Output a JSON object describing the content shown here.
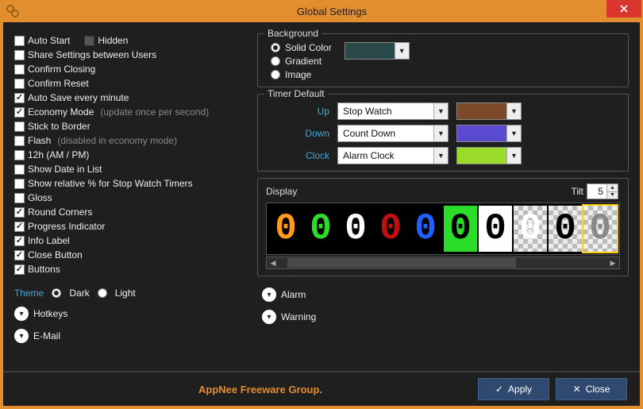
{
  "window": {
    "title": "Global Settings"
  },
  "left": {
    "options": [
      {
        "label": "Auto Start",
        "checked": false
      },
      {
        "label": "Share Settings between Users",
        "checked": false
      },
      {
        "label": "Confirm Closing",
        "checked": false
      },
      {
        "label": "Confirm Reset",
        "checked": false
      },
      {
        "label": "Auto Save every minute",
        "checked": true
      },
      {
        "label": "Economy Mode",
        "checked": true,
        "note": "(update once per second)"
      },
      {
        "label": "Stick to Border",
        "checked": false
      },
      {
        "label": "Flash",
        "checked": false,
        "note": "(disabled in economy mode)"
      },
      {
        "label": "12h (AM / PM)",
        "checked": false
      },
      {
        "label": "Show Date in List",
        "checked": false
      },
      {
        "label": "Show relative % for Stop Watch Timers",
        "checked": false
      },
      {
        "label": "Gloss",
        "checked": false
      },
      {
        "label": "Round Corners",
        "checked": true
      },
      {
        "label": "Progress Indicator",
        "checked": true
      },
      {
        "label": "Info Label",
        "checked": true
      },
      {
        "label": "Close Button",
        "checked": true
      },
      {
        "label": "Buttons",
        "checked": true
      }
    ],
    "hidden": {
      "label": "Hidden",
      "checked": false
    },
    "theme": {
      "label": "Theme",
      "dark": "Dark",
      "light": "Light",
      "selected": "dark"
    },
    "hotkeys": "Hotkeys",
    "email": "E-Mail"
  },
  "background": {
    "title": "Background",
    "solid": "Solid Color",
    "gradient": "Gradient",
    "image": "Image",
    "selected": "solid",
    "color": "#2a4a4a"
  },
  "timer_default": {
    "title": "Timer Default",
    "rows": [
      {
        "label": "Up",
        "value": "Stop Watch",
        "color": "#7a4a2a"
      },
      {
        "label": "Down",
        "value": "Count Down",
        "color": "#5a4acf"
      },
      {
        "label": "Clock",
        "value": "Alarm Clock",
        "color": "#9bdc2a"
      }
    ]
  },
  "display": {
    "title": "Display",
    "tilt_label": "Tilt",
    "tilt_value": "5",
    "cells": [
      {
        "bg": "#000000",
        "fg": "#ff9a1a"
      },
      {
        "bg": "#000000",
        "fg": "#2bdc2b"
      },
      {
        "bg": "#000000",
        "fg": "#ffffff"
      },
      {
        "bg": "#000000",
        "fg": "#c01010"
      },
      {
        "bg": "#000000",
        "fg": "#2060ff"
      },
      {
        "bg": "#2bdc2b",
        "fg": "#000000"
      },
      {
        "bg": "#ffffff",
        "fg": "#000000"
      },
      {
        "bg": "transparent",
        "fg": "#ffffff"
      },
      {
        "bg": "transparent",
        "fg": "#000000"
      },
      {
        "bg": "transparent",
        "fg": "#888888",
        "selected": true
      }
    ]
  },
  "disclosures": {
    "alarm": "Alarm",
    "warning": "Warning"
  },
  "footer": {
    "brand": "AppNee Freeware Group.",
    "apply": "Apply",
    "close": "Close"
  }
}
